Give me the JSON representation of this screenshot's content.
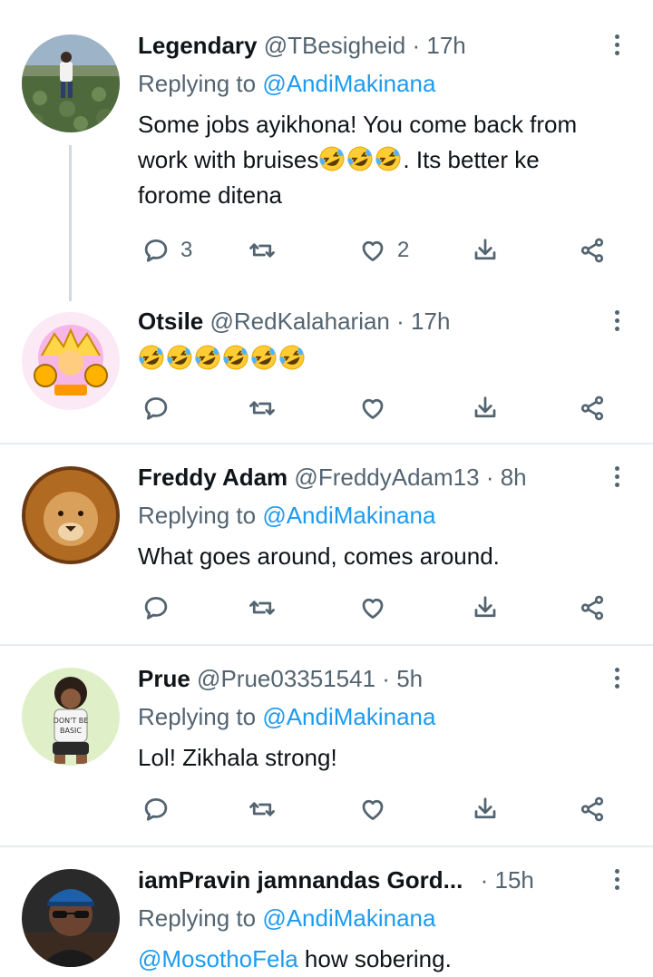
{
  "tweets": [
    {
      "name": "Legendary",
      "handle": "@TBesigheid",
      "separator": "·",
      "time": "17h",
      "replying_prefix": "Replying to ",
      "replying_to": "@AndiMakinana",
      "body_part1": "Some jobs ayikhona! You come back from work with bruises",
      "body_part2": ". Its better ke forome ditena",
      "emoji_after_part1": [
        "rolling-on-floor-laughing",
        "rolling-on-floor-laughing",
        "rolling-on-floor-laughing"
      ],
      "reply_count": "3",
      "like_count": "2"
    },
    {
      "name": "Otsile",
      "handle": "@RedKalaharian",
      "separator": "·",
      "time": "17h",
      "emoji_body": [
        "rolling-on-floor-laughing",
        "rolling-on-floor-laughing",
        "rolling-on-floor-laughing",
        "rolling-on-floor-laughing",
        "rolling-on-floor-laughing",
        "rolling-on-floor-laughing"
      ]
    },
    {
      "name": "Freddy Adam",
      "handle": "@FreddyAdam13",
      "separator": "·",
      "time": "8h",
      "replying_prefix": "Replying to ",
      "replying_to": "@AndiMakinana",
      "body": "What goes around, comes around."
    },
    {
      "name": "Prue",
      "handle": "@Prue03351541",
      "separator": "·",
      "time": "5h",
      "replying_prefix": "Replying to ",
      "replying_to": "@AndiMakinana",
      "body": "Lol! Zikhala strong!",
      "avatar_text": "DON'T BE BASIC"
    },
    {
      "name": "iamPravin jamnandas Gord...",
      "handle": "",
      "separator": "·",
      "time": "15h",
      "replying_prefix": "Replying to ",
      "replying_to": "@AndiMakinana",
      "body_mention": "@MosothoFela",
      "body_rest": " how sobering."
    }
  ],
  "icons": {
    "reply": "reply-icon",
    "retweet": "retweet-icon",
    "like": "heart-icon",
    "share": "share-icon",
    "download": "download-icon",
    "more": "more-options-icon"
  },
  "colors": {
    "mention": "#1d9bf0",
    "secondary_text": "#536471",
    "divider": "#e6ecf0"
  }
}
